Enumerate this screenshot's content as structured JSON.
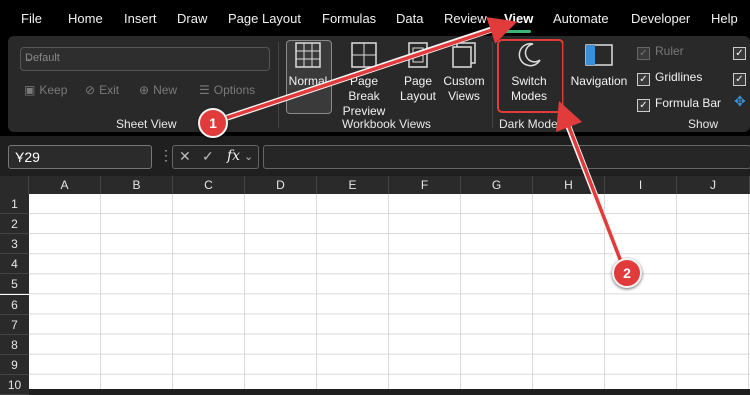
{
  "menu": {
    "items": [
      "File",
      "Home",
      "Insert",
      "Draw",
      "Page Layout",
      "Formulas",
      "Data",
      "Review",
      "View",
      "Automate",
      "Developer",
      "Help"
    ],
    "active": "View",
    "accent_color": "#3db57a"
  },
  "sheet_view": {
    "dropdown_value": "Default",
    "keep": "Keep",
    "exit": "Exit",
    "new": "New",
    "options": "Options",
    "label": "Sheet View"
  },
  "workbook_views": {
    "normal": "Normal",
    "page_break_1": "Page Break",
    "page_break_2": "Preview",
    "page_layout_1": "Page",
    "page_layout_2": "Layout",
    "custom_views_1": "Custom",
    "custom_views_2": "Views",
    "label": "Workbook Views"
  },
  "dark_mode": {
    "switch_1": "Switch",
    "switch_2": "Modes",
    "label": "Dark Mode"
  },
  "show": {
    "navigation": "Navigation",
    "ruler": "Ruler",
    "gridlines": "Gridlines",
    "formula_bar": "Formula Bar",
    "label": "Show"
  },
  "formula_bar": {
    "name_box": "Y29",
    "fx": "fx",
    "cancel": "✕",
    "enter": "✓",
    "formula": ""
  },
  "grid": {
    "columns": [
      "A",
      "B",
      "C",
      "D",
      "E",
      "F",
      "G",
      "H",
      "I",
      "J"
    ],
    "rows": [
      "1",
      "2",
      "3",
      "4",
      "5",
      "6",
      "7",
      "8",
      "9",
      "10"
    ]
  },
  "annotations": {
    "badge_1": "1",
    "badge_2": "2",
    "color": "#e23b3b"
  }
}
